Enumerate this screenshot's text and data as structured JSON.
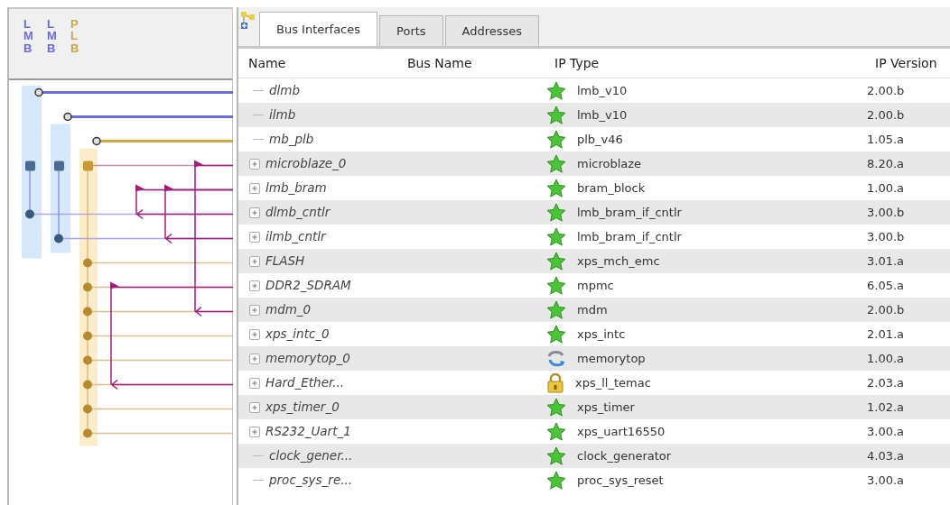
{
  "bus_panel": {
    "buses": [
      {
        "label": "LMB",
        "color": "#6b6be0"
      },
      {
        "label": "LMB",
        "color": "#6b6be0"
      },
      {
        "label": "PLB",
        "color": "#d2a445"
      }
    ]
  },
  "tabs": [
    {
      "label": "Bus Interfaces",
      "selected": true
    },
    {
      "label": "Ports",
      "selected": false
    },
    {
      "label": "Addresses",
      "selected": false
    }
  ],
  "table": {
    "columns": [
      "Name",
      "Bus Name",
      "IP Type",
      "IP Version"
    ],
    "rows": [
      {
        "name": "dlmb",
        "expandable": false,
        "kind": "star",
        "ip_type": "lmb_v10",
        "ip_version": "2.00.b"
      },
      {
        "name": "ilmb",
        "expandable": false,
        "kind": "star",
        "ip_type": "lmb_v10",
        "ip_version": "2.00.b"
      },
      {
        "name": "mb_plb",
        "expandable": false,
        "kind": "star",
        "ip_type": "plb_v46",
        "ip_version": "1.05.a"
      },
      {
        "name": "microblaze_0",
        "expandable": true,
        "kind": "star",
        "ip_type": "microblaze",
        "ip_version": "8.20.a"
      },
      {
        "name": "lmb_bram",
        "expandable": true,
        "kind": "star",
        "ip_type": "bram_block",
        "ip_version": "1.00.a"
      },
      {
        "name": "dlmb_cntlr",
        "expandable": true,
        "kind": "star",
        "ip_type": "lmb_bram_if_cntlr",
        "ip_version": "3.00.b"
      },
      {
        "name": "ilmb_cntlr",
        "expandable": true,
        "kind": "star",
        "ip_type": "lmb_bram_if_cntlr",
        "ip_version": "3.00.b"
      },
      {
        "name": "FLASH",
        "expandable": true,
        "kind": "star",
        "ip_type": "xps_mch_emc",
        "ip_version": "3.01.a"
      },
      {
        "name": "DDR2_SDRAM",
        "expandable": true,
        "kind": "star",
        "ip_type": "mpmc",
        "ip_version": "6.05.a"
      },
      {
        "name": "mdm_0",
        "expandable": true,
        "kind": "star",
        "ip_type": "mdm",
        "ip_version": "2.00.b"
      },
      {
        "name": "xps_intc_0",
        "expandable": true,
        "kind": "star",
        "ip_type": "xps_intc",
        "ip_version": "2.01.a"
      },
      {
        "name": "memorytop_0",
        "expandable": true,
        "kind": "swirl",
        "ip_type": "memorytop",
        "ip_version": "1.00.a"
      },
      {
        "name": "Hard_Ether...",
        "expandable": true,
        "kind": "lock",
        "ip_type": "xps_ll_temac",
        "ip_version": "2.03.a"
      },
      {
        "name": "xps_timer_0",
        "expandable": true,
        "kind": "star",
        "ip_type": "xps_timer",
        "ip_version": "1.02.a"
      },
      {
        "name": "RS232_Uart_1",
        "expandable": true,
        "kind": "star",
        "ip_type": "xps_uart16550",
        "ip_version": "3.00.a"
      },
      {
        "name": "clock_gener...",
        "expandable": false,
        "kind": "star",
        "ip_type": "clock_generator",
        "ip_version": "4.03.a"
      },
      {
        "name": "proc_sys_re...",
        "expandable": false,
        "kind": "star",
        "ip_type": "proc_sys_reset",
        "ip_version": "3.00.a"
      }
    ]
  }
}
